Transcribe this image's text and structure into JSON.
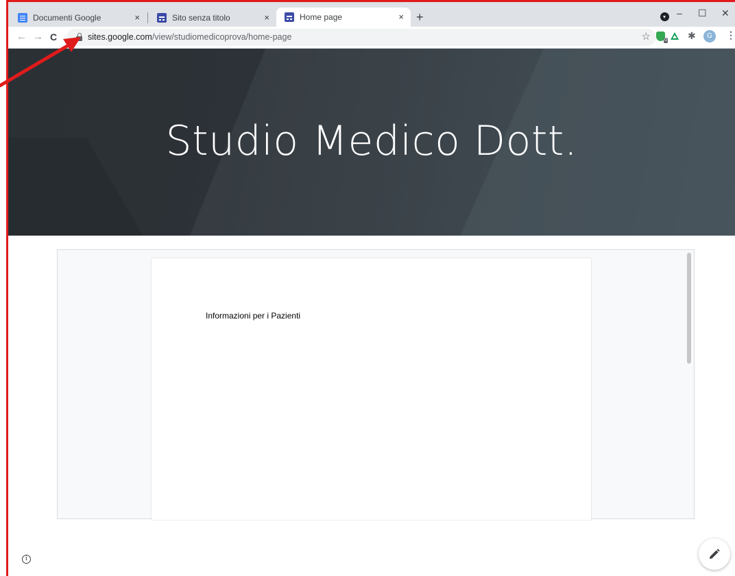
{
  "browser": {
    "tabs": [
      {
        "title": "Documenti Google",
        "icon": "google-docs-icon",
        "active": false
      },
      {
        "title": "Sito senza titolo",
        "icon": "google-sites-icon",
        "active": false
      },
      {
        "title": "Home page",
        "icon": "google-sites-icon",
        "active": true
      }
    ],
    "close_glyph": "×",
    "new_tab_glyph": "+",
    "window_controls": {
      "minimize": "–",
      "maximize": "☐",
      "close": "✕"
    },
    "address_bar": {
      "domain": "sites.google.com",
      "path": "/view/studiomedicoprova/home-page"
    },
    "profile_initial": "G",
    "extension_badge": "0"
  },
  "site": {
    "hero_title": "Studio Medico Dott.",
    "embedded_doc_text": "Informazioni per i Pazienti"
  },
  "colors": {
    "annotation_red": "#e01b1b",
    "hero_bg": "#394046",
    "tabstrip_bg": "#dee1e6"
  }
}
